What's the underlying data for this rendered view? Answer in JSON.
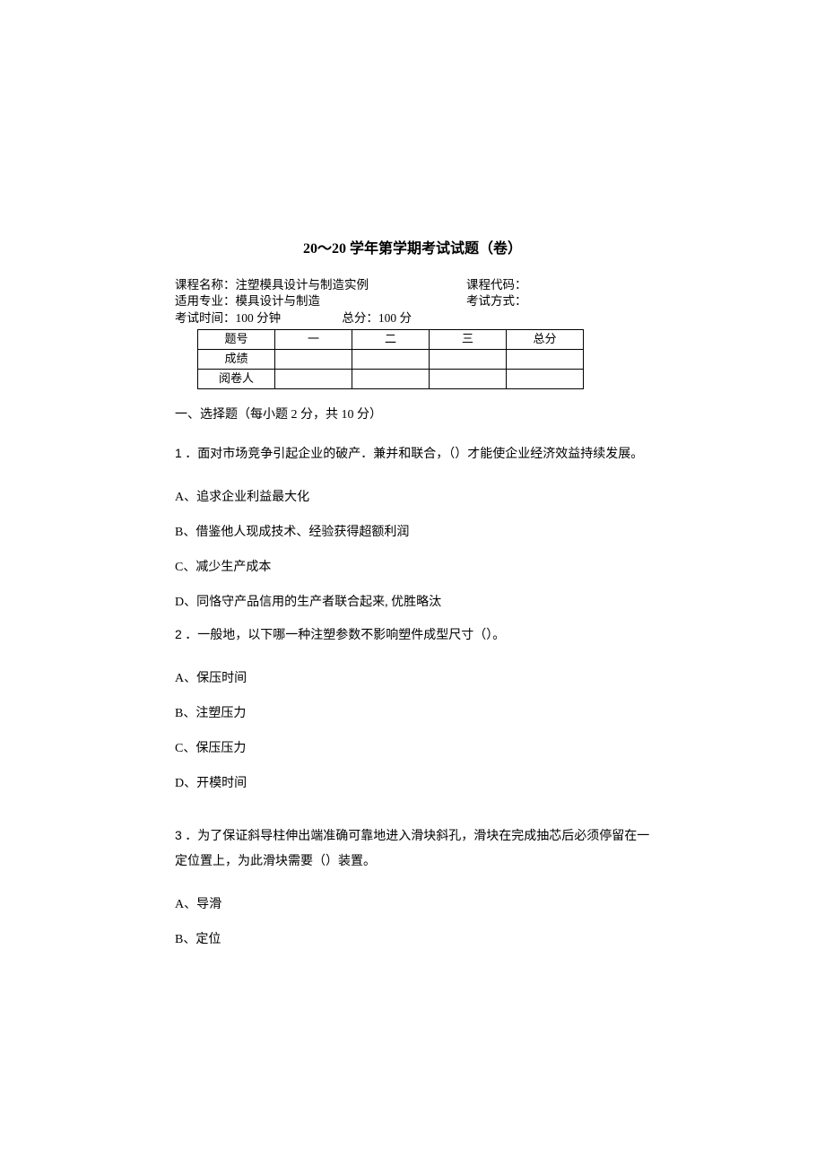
{
  "title": "20～20 学年第学期考试试题（卷）",
  "meta": {
    "course_name_label": "课程名称：",
    "course_name_value": "注塑模具设计与制造实例",
    "course_code_label": "课程代码：",
    "major_label": "适用专业：",
    "major_value": "模具设计与制造",
    "exam_mode_label": "考试方式：",
    "time_label": "考试时间：",
    "time_value": "100 分钟",
    "total_label": "总分：",
    "total_value": "100 分"
  },
  "score_table": {
    "row_labels": [
      "题号",
      "成绩",
      "阅卷人"
    ],
    "columns": [
      "一",
      "二",
      "三",
      "总分"
    ]
  },
  "section1_header": "一、选择题（每小题 2 分，共 10 分）",
  "questions": [
    {
      "num": "1",
      "stem": " ．面对市场竞争引起企业的破产．兼并和联合，（）才能使企业经济效益持续发展。",
      "options": [
        "A、追求企业利益最大化",
        "B、借鉴他人现成技术、经验获得超额利润",
        "C、减少生产成本",
        "D、同恪守产品信用的生产者联合起来, 优胜略汰"
      ]
    },
    {
      "num": "2",
      "stem": " ．一般地，以下哪一种注塑参数不影响塑件成型尺寸（）。",
      "options": [
        "A、保压时间",
        "B、注塑压力",
        "C、保压压力",
        "D、开模时间"
      ]
    },
    {
      "num": "3",
      "stem": " ．为了保证斜导柱伸出端准确可靠地进入滑块斜孔，滑块在完成抽芯后必须停留在一定位置上，为此滑块需要（）装置。",
      "options": [
        "A、导滑",
        "B、定位"
      ]
    }
  ]
}
